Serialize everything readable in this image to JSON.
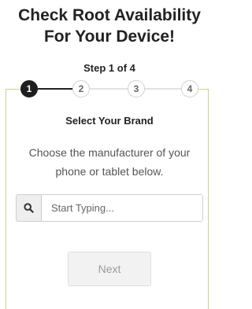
{
  "page": {
    "title_line1": "Check Root Availability",
    "title_line2": "For Your Device!"
  },
  "wizard": {
    "step_label": "Step 1 of 4",
    "current_step": 1,
    "total_steps": 4,
    "steps": [
      {
        "number": "1",
        "state": "active"
      },
      {
        "number": "2",
        "state": "inactive"
      },
      {
        "number": "3",
        "state": "inactive"
      },
      {
        "number": "4",
        "state": "inactive"
      }
    ]
  },
  "brand_section": {
    "heading": "Select Your Brand",
    "instructions": "Choose the manufacturer of your phone or tablet below."
  },
  "search": {
    "icon": "search-icon",
    "placeholder": "Start Typing...",
    "value": ""
  },
  "actions": {
    "next_label": "Next",
    "next_enabled": false
  },
  "colors": {
    "panel_border": "#c9d48a",
    "active_step": "#1e1e1e",
    "disabled_button_bg": "#f2f2f2"
  }
}
